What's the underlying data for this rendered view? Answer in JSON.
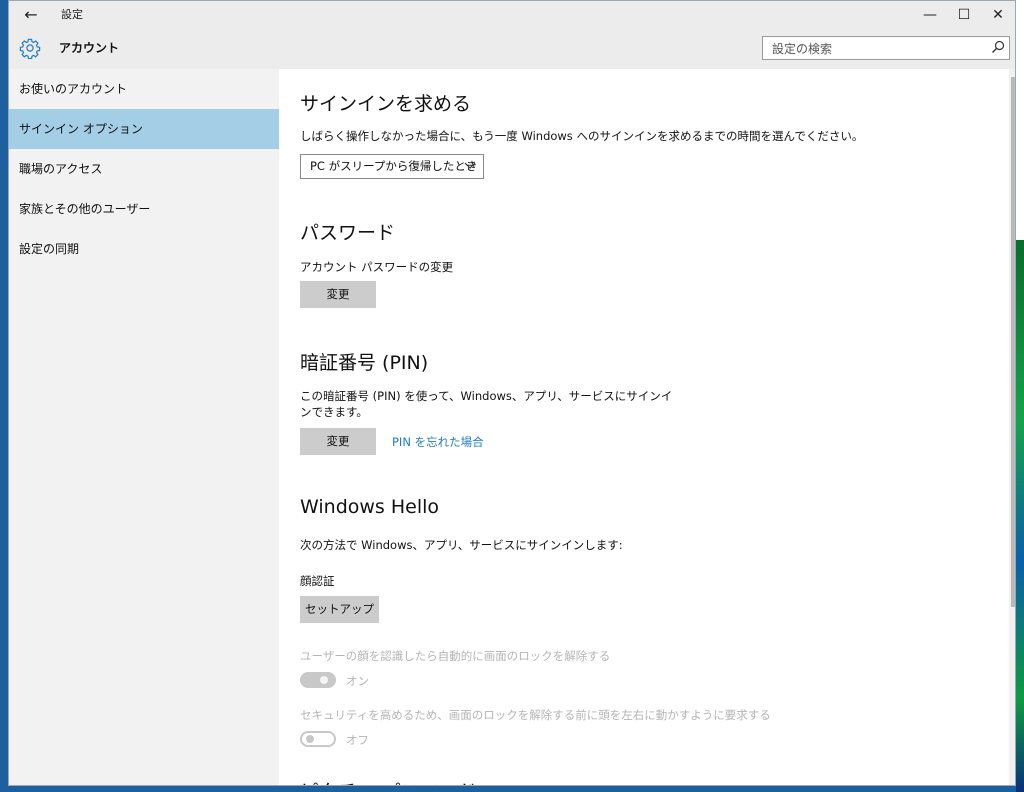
{
  "window": {
    "title": "設定",
    "back_icon": "←",
    "minimize_icon": "—",
    "maximize_icon": "☐",
    "close_icon": "✕"
  },
  "header": {
    "title": "アカウント",
    "icon": "gear-icon",
    "search_placeholder": "設定の検索"
  },
  "sidebar": {
    "items": [
      {
        "label": "お使いのアカウント",
        "active": false
      },
      {
        "label": "サインイン オプション",
        "active": true
      },
      {
        "label": "職場のアクセス",
        "active": false
      },
      {
        "label": "家族とその他のユーザー",
        "active": false
      },
      {
        "label": "設定の同期",
        "active": false
      }
    ]
  },
  "main": {
    "signin": {
      "title": "サインインを求める",
      "description": "しばらく操作しなかった場合に、もう一度 Windows へのサインインを求めるまでの時間を選んでください。",
      "dropdown_value": "PC がスリープから復帰したとき"
    },
    "password": {
      "title": "パスワード",
      "label": "アカウント パスワードの変更",
      "button": "変更"
    },
    "pin": {
      "title": "暗証番号 (PIN)",
      "description": "この暗証番号 (PIN) を使って、Windows、アプリ、サービスにサインインできます。",
      "button": "変更",
      "forgot_link": "PIN を忘れた場合"
    },
    "hello": {
      "title": "Windows Hello",
      "description": "次の方法で Windows、アプリ、サービスにサインインします:",
      "face_label": "顔認証",
      "setup_button": "セットアップ",
      "auto_unlock_label": "ユーザーの顔を認識したら自動的に画面のロックを解除する",
      "auto_unlock_state": "オン",
      "head_turn_label": "セキュリティを高めるため、画面のロックを解除する前に頭を左右に動かすように要求する",
      "head_turn_state": "オフ"
    },
    "next_section_partial": "ピクチャ パスワード"
  },
  "colors": {
    "accent": "#1f7bc4",
    "nav_active": "#a4cde6",
    "button_bg": "#cccccc",
    "chrome_bg": "#ececec"
  }
}
